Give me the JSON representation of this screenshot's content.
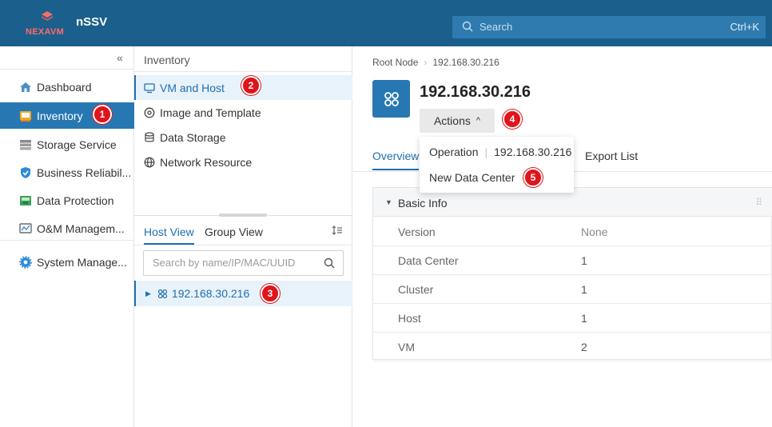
{
  "header": {
    "logo_text_a": "NEX",
    "logo_text_b": "AVM",
    "app_name": "nSSV",
    "search_placeholder": "Search",
    "search_shortcut": "Ctrl+K"
  },
  "leftnav": {
    "collapse_glyph": "«",
    "items": [
      {
        "label": "Dashboard",
        "icon": "home-icon"
      },
      {
        "label": "Inventory",
        "icon": "inventory-icon"
      },
      {
        "label": "Storage Service",
        "icon": "storage-icon"
      },
      {
        "label": "Business Reliabil...",
        "icon": "shield-icon"
      },
      {
        "label": "Data Protection",
        "icon": "data-protection-icon"
      },
      {
        "label": "O&M Managem...",
        "icon": "monitor-icon"
      },
      {
        "label": "System Manage...",
        "icon": "gear-icon"
      }
    ]
  },
  "middle": {
    "title": "Inventory",
    "items": [
      {
        "label": "VM and Host",
        "icon": "monitor-icon"
      },
      {
        "label": "Image and Template",
        "icon": "disc-icon"
      },
      {
        "label": "Data Storage",
        "icon": "database-icon"
      },
      {
        "label": "Network Resource",
        "icon": "globe-icon"
      }
    ],
    "tabs": [
      "Host View",
      "Group View"
    ],
    "search_placeholder": "Search by name/IP/MAC/UUID",
    "tree_node": "192.168.30.216"
  },
  "main": {
    "breadcrumb": [
      "Root Node",
      "192.168.30.216"
    ],
    "title": "192.168.30.216",
    "actions_label": "Actions",
    "tabs": [
      "Overview",
      "Export List"
    ],
    "dropdown": {
      "header_label": "Operation",
      "header_value": "192.168.30.216",
      "item": "New Data Center"
    },
    "basic_info": {
      "title": "Basic Info",
      "rows": [
        {
          "key": "Version",
          "value": "None"
        },
        {
          "key": "Data Center",
          "value": "1"
        },
        {
          "key": "Cluster",
          "value": "1"
        },
        {
          "key": "Host",
          "value": "1"
        },
        {
          "key": "VM",
          "value": "2"
        }
      ]
    }
  },
  "badges": [
    "1",
    "2",
    "3",
    "4",
    "5"
  ],
  "colors": {
    "topbar": "#1b5f8c",
    "accent": "#1d6fb0",
    "active_nav": "#2778b2",
    "badge": "#e0141a"
  }
}
